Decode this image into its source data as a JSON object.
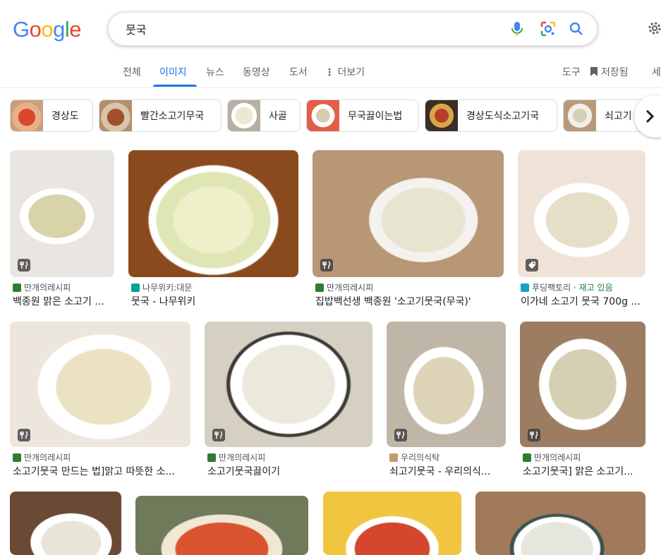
{
  "logo": {
    "letters": [
      "G",
      "o",
      "o",
      "g",
      "l",
      "e"
    ],
    "colors": [
      "#4285f4",
      "#ea4335",
      "#fbbc05",
      "#4285f4",
      "#34a853",
      "#ea4335"
    ]
  },
  "search": {
    "query": "뭇국",
    "icons": [
      "microphone-icon",
      "lens-icon",
      "search-icon"
    ]
  },
  "tabs": [
    {
      "label": "전체",
      "active": false
    },
    {
      "label": "이미지",
      "active": true
    },
    {
      "label": "뉴스",
      "active": false
    },
    {
      "label": "동영상",
      "active": false
    },
    {
      "label": "도서",
      "active": false
    },
    {
      "label": "더보기",
      "active": false
    }
  ],
  "right_tools": {
    "tools": "도구",
    "saved": "저장됨",
    "extra": "세"
  },
  "chips": [
    "경상도",
    "빨간소고기무국",
    "사골",
    "무국끓이는법",
    "경상도식소고기국",
    "쇠고기"
  ],
  "results": [
    {
      "source": "만개의레시피",
      "title": "백종원 맑은 소고기 ...",
      "badge": "recipe-icon",
      "fav_color": "#2e7d32"
    },
    {
      "source": "나무위키:대문",
      "title": "뭇국 - 나무위키",
      "badge": "",
      "fav_color": "#00a495"
    },
    {
      "source": "만개의레시피",
      "title": "집밥백선생 백종원 '소고기뭇국(무국)'",
      "badge": "recipe-icon",
      "fav_color": "#2e7d32"
    },
    {
      "source": "푸딩팩토리",
      "stock": "재고 있음",
      "title": "이가네 소고기 뭇국 700g ...",
      "badge": "tag-icon",
      "fav_color": "#1aa0c4"
    },
    {
      "source": "만개의레시피",
      "title": "소고기뭇국 만드는 법]맑고 따뜻한 소...",
      "badge": "recipe-icon",
      "fav_color": "#2e7d32"
    },
    {
      "source": "만개의레시피",
      "title": "소고기뭇국끓이기",
      "badge": "recipe-icon",
      "fav_color": "#2e7d32"
    },
    {
      "source": "우리의식탁",
      "title": "쇠고기뭇국 - 우리의식...",
      "badge": "recipe-icon",
      "fav_color": "#c59a6d"
    },
    {
      "source": "만개의레시피",
      "title": "소고기뭇국] 맑은 소고기...",
      "badge": "recipe-icon",
      "fav_color": "#2e7d32"
    }
  ]
}
